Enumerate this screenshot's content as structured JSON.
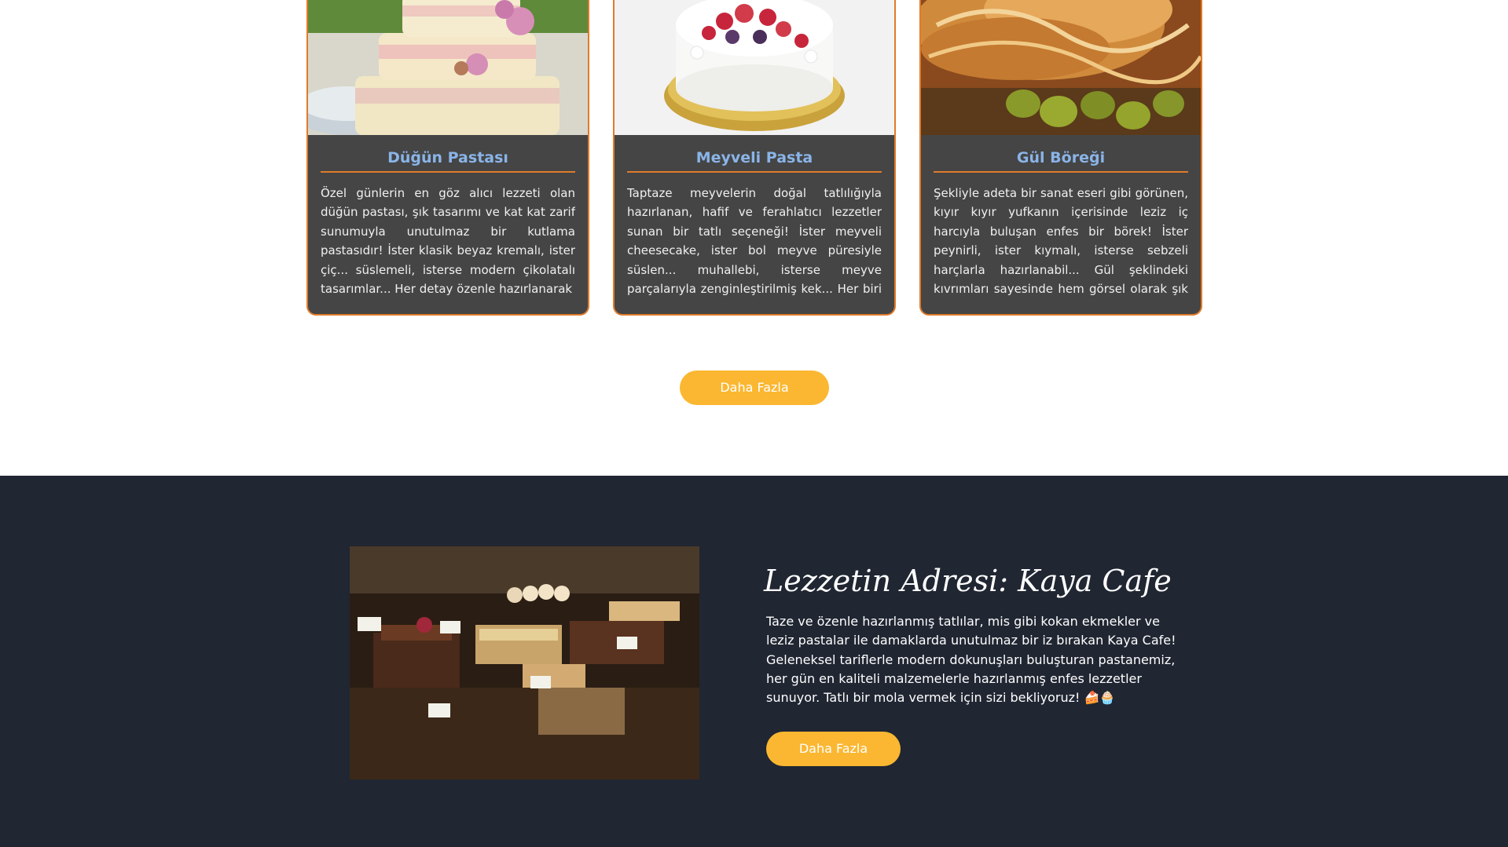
{
  "products": {
    "cards": [
      {
        "title": "Düğün Pastası",
        "text": "Özel günlerin en göz alıcı lezzeti olan düğün pastası, şık tasarımı ve kat kat zarif sunumuyla unutulmaz bir kutlama pastasıdır! İster klasik beyaz kremalı, ister çiç... süslemeli, isterse modern çikolatalı tasarımlar... Her detay özenle hazırlanarak",
        "image_alt": "wedding-cake-image"
      },
      {
        "title": "Meyveli Pasta",
        "text": "Taptaze meyvelerin doğal tatlılığıyla hazırlanan, hafif ve ferahlatıcı lezzetler sunan bir tatlı seçeneği! İster meyveli cheesecake, ister bol meyve püresiyle süslen... muhallebi, isterse meyve parçalarıyla zenginleştirilmiş kek... Her biri hem görsel",
        "image_alt": "fruit-cake-image"
      },
      {
        "title": "Gül Böreği",
        "text": "Şekliyle adeta bir sanat eseri gibi görünen, kıyır kıyır yufkanın içerisinde leziz iç harcıyla buluşan enfes bir börek! İster peynirli, ister kıymalı, isterse sebzeli harçlarla hazırlanabil... Gül şeklindeki kıvrımları sayesinde hem görsel olarak şık hem de lezzet açısından",
        "image_alt": "rose-borek-image"
      }
    ],
    "more_button": "Daha Fazla"
  },
  "about": {
    "title": "Lezzetin Adresi: Kaya Cafe",
    "text": "Taze ve özenle hazırlanmış tatlılar, mis gibi kokan ekmekler ve leziz pastalar ile damaklarda unutulmaz bir iz bırakan Kaya Cafe! Geleneksel tariflerle modern dokunuşları buluşturan pastanemiz, her gün en kaliteli malzemelerle hazırlanmış enfes lezzetler sunuyor. Tatlı bir mola vermek için sizi bekliyoruz! 🍰🧁",
    "more_button": "Daha Fazla"
  },
  "colors": {
    "accent": "#fbb731",
    "card_border": "#e07b2a",
    "card_bg": "#454545",
    "card_title": "#8ab4e8",
    "dark_bg": "#202632"
  }
}
